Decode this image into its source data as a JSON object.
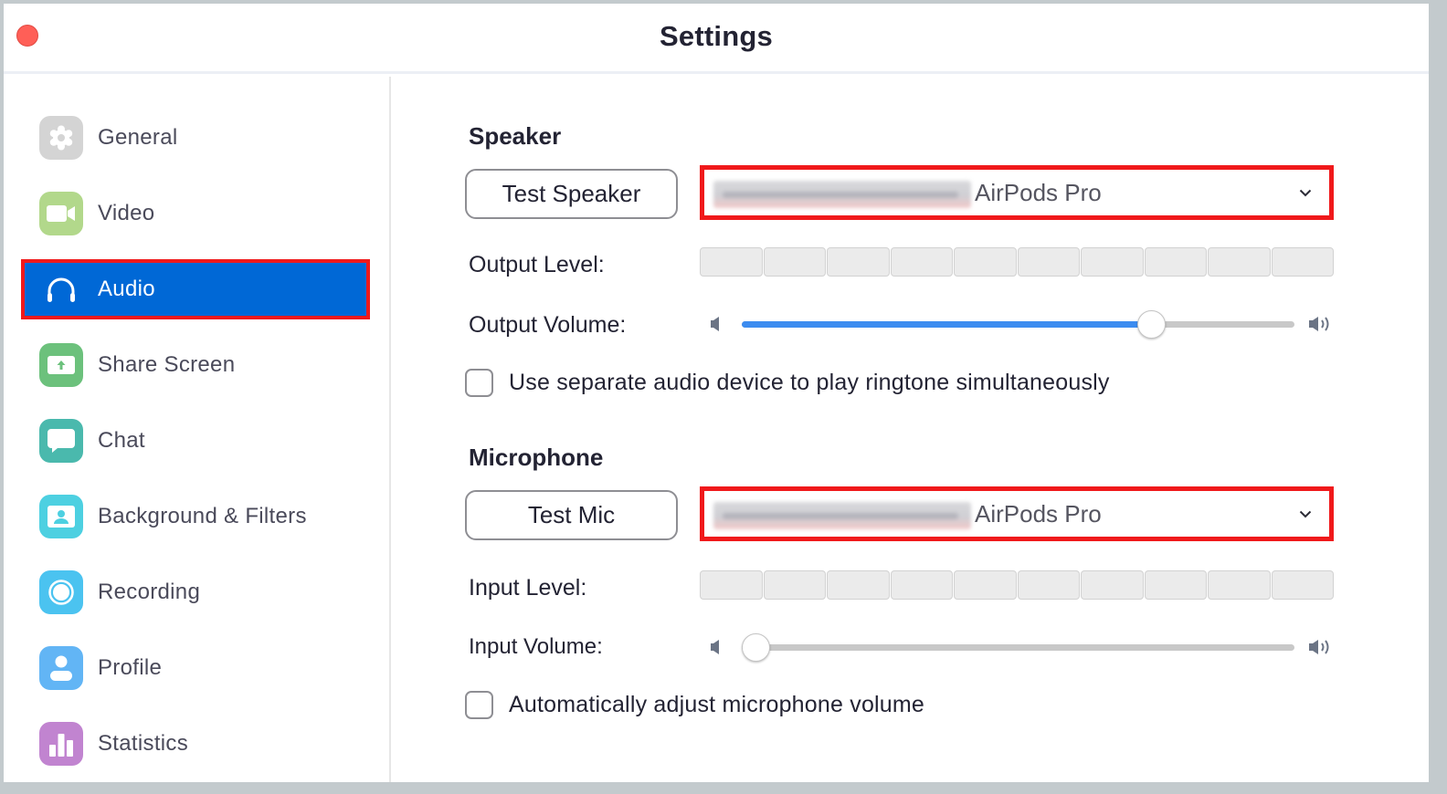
{
  "window": {
    "title": "Settings"
  },
  "sidebar": {
    "items": [
      {
        "id": "general",
        "label": "General",
        "icon": "gear-icon",
        "color": "#d4d4d4",
        "active": false
      },
      {
        "id": "video",
        "label": "Video",
        "icon": "video-camera-icon",
        "color": "#b2d88b",
        "active": false
      },
      {
        "id": "audio",
        "label": "Audio",
        "icon": "headphones-icon",
        "color": "#0068d6",
        "active": true
      },
      {
        "id": "share-screen",
        "label": "Share Screen",
        "icon": "share-screen-icon",
        "color": "#6cc17c",
        "active": false
      },
      {
        "id": "chat",
        "label": "Chat",
        "icon": "chat-bubble-icon",
        "color": "#4ab9ad",
        "active": false
      },
      {
        "id": "background-filters",
        "label": "Background & Filters",
        "icon": "background-person-icon",
        "color": "#4dd0e1",
        "active": false
      },
      {
        "id": "recording",
        "label": "Recording",
        "icon": "record-icon",
        "color": "#4bc3f0",
        "active": false
      },
      {
        "id": "profile",
        "label": "Profile",
        "icon": "profile-person-icon",
        "color": "#62b5f5",
        "active": false
      },
      {
        "id": "statistics",
        "label": "Statistics",
        "icon": "bar-chart-icon",
        "color": "#c184d0",
        "active": false
      }
    ]
  },
  "speaker": {
    "section_title": "Speaker",
    "test_button": "Test Speaker",
    "device_name_suffix": "AirPods Pro",
    "device_name_redacted": true,
    "output_level_label": "Output Level:",
    "output_level_segments": 10,
    "output_level_value": 0,
    "output_volume_label": "Output Volume:",
    "output_volume_value": 0.74,
    "ringtone_checkbox_label": "Use separate audio device to play ringtone simultaneously",
    "ringtone_checkbox_checked": false
  },
  "microphone": {
    "section_title": "Microphone",
    "test_button": "Test Mic",
    "device_name_suffix": "AirPods Pro",
    "device_name_redacted": true,
    "input_level_label": "Input Level:",
    "input_level_segments": 10,
    "input_level_value": 0,
    "input_volume_label": "Input Volume:",
    "input_volume_value": 0.0,
    "auto_adjust_checkbox_label": "Automatically adjust microphone volume",
    "auto_adjust_checkbox_checked": false
  },
  "colors": {
    "accent": "#0068d6",
    "highlight_outline": "#f0191b",
    "slider_fill": "#3c8cf0",
    "close_button": "#ff5f57"
  }
}
